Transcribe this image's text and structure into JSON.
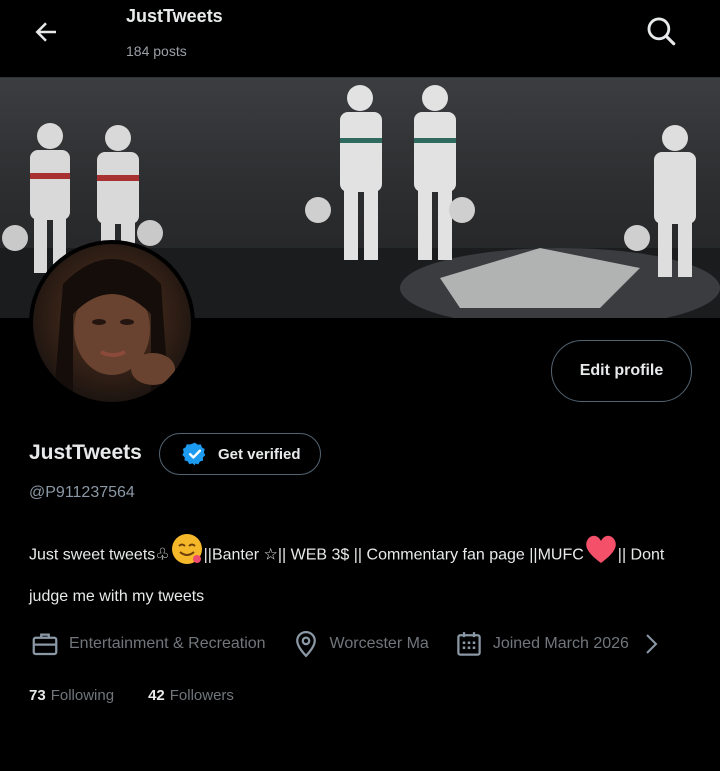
{
  "header": {
    "title": "JustTweets",
    "posts": "184 posts",
    "back_icon": "arrow-left-icon",
    "search_icon": "search-icon"
  },
  "profile": {
    "name": "JustTweets",
    "handle": "@P911237564",
    "edit_label": "Edit profile",
    "verify_label": "Get verified",
    "bio_part1": "Just sweet tweets♧",
    "bio_part2": "||Banter ☆|| WEB 3$ || Commentary fan page ||MUFC",
    "bio_part3": "|| Dont judge me with my tweets",
    "category": "Entertainment & Recreation",
    "location": "Worcester Ma",
    "joined": "Joined March 2026",
    "following_count": "73",
    "following_label": "Following",
    "followers_count": "42",
    "followers_label": "Followers"
  },
  "colors": {
    "background": "#000000",
    "text": "#e7e9ea",
    "muted": "#71767b",
    "verify_blue": "#1d9bf0",
    "heart": "#f4506a"
  }
}
